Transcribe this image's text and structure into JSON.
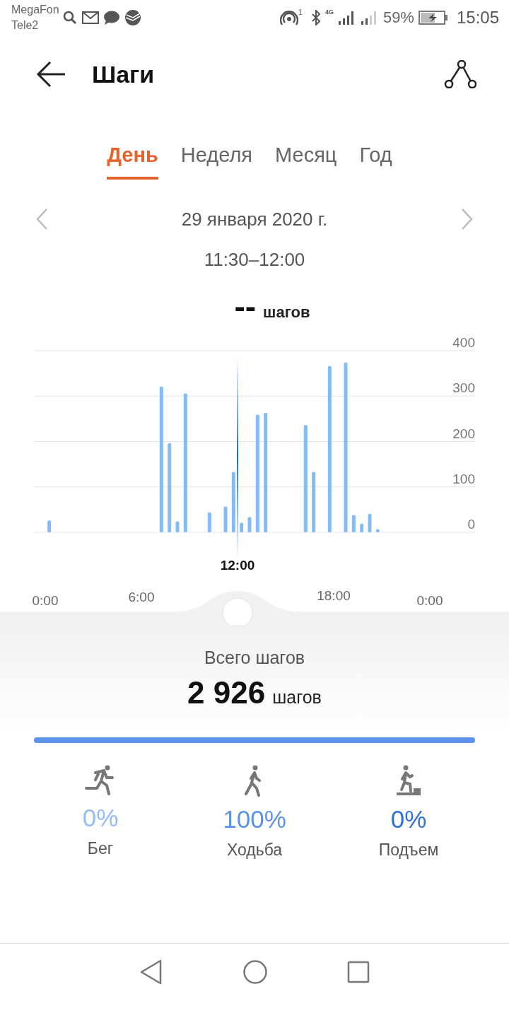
{
  "status_bar": {
    "carriers": [
      "MegaFon",
      "Tele2"
    ],
    "hotspot_badge": "1",
    "network": "4G",
    "battery": "59%",
    "time": "15:05"
  },
  "header": {
    "title": "Шаги"
  },
  "tabs": [
    {
      "label": "День",
      "selected": true
    },
    {
      "label": "Неделя",
      "selected": false
    },
    {
      "label": "Месяц",
      "selected": false
    },
    {
      "label": "Год",
      "selected": false
    }
  ],
  "date_nav": {
    "date": "29 января 2020 г.",
    "interval": "11:30–12:00"
  },
  "selection": {
    "value": "--",
    "unit": "шагов"
  },
  "chart_data": {
    "type": "bar",
    "x": [
      0,
      7,
      7.5,
      8,
      8.5,
      10,
      11,
      11.5,
      12,
      12.5,
      13,
      13.5,
      16,
      16.5,
      17.5,
      18.5,
      19,
      19.5,
      20,
      20.5
    ],
    "values": [
      26,
      321,
      196,
      24,
      306,
      44,
      57,
      133,
      21,
      34,
      259,
      263,
      236,
      133,
      366,
      374,
      38,
      19,
      41,
      7
    ],
    "xlim": [
      0,
      24
    ],
    "ylim": [
      0,
      400
    ],
    "yticks": [
      0,
      100,
      200,
      300,
      400
    ],
    "xticks": [
      {
        "value": 0,
        "label": "0:00"
      },
      {
        "value": 6,
        "label": "6:00"
      },
      {
        "value": 18,
        "label": "18:00"
      },
      {
        "value": 24,
        "label": "0:00"
      }
    ],
    "grid": true,
    "ref_lines": [
      {
        "axis": "x",
        "value": 12,
        "label": "12:00"
      }
    ]
  },
  "summary": {
    "label": "Всего шагов",
    "value": "2 926",
    "unit": "шагов"
  },
  "activities": [
    {
      "kind": "run",
      "percent": "0%",
      "label": "Бег",
      "color": "#94bdf5"
    },
    {
      "kind": "walk",
      "percent": "100%",
      "label": "Ходьба",
      "color": "#5b93ec",
      "level": 1
    },
    {
      "kind": "climb",
      "percent": "0%",
      "label": "Подъем",
      "color": "#2f6fe0"
    }
  ]
}
